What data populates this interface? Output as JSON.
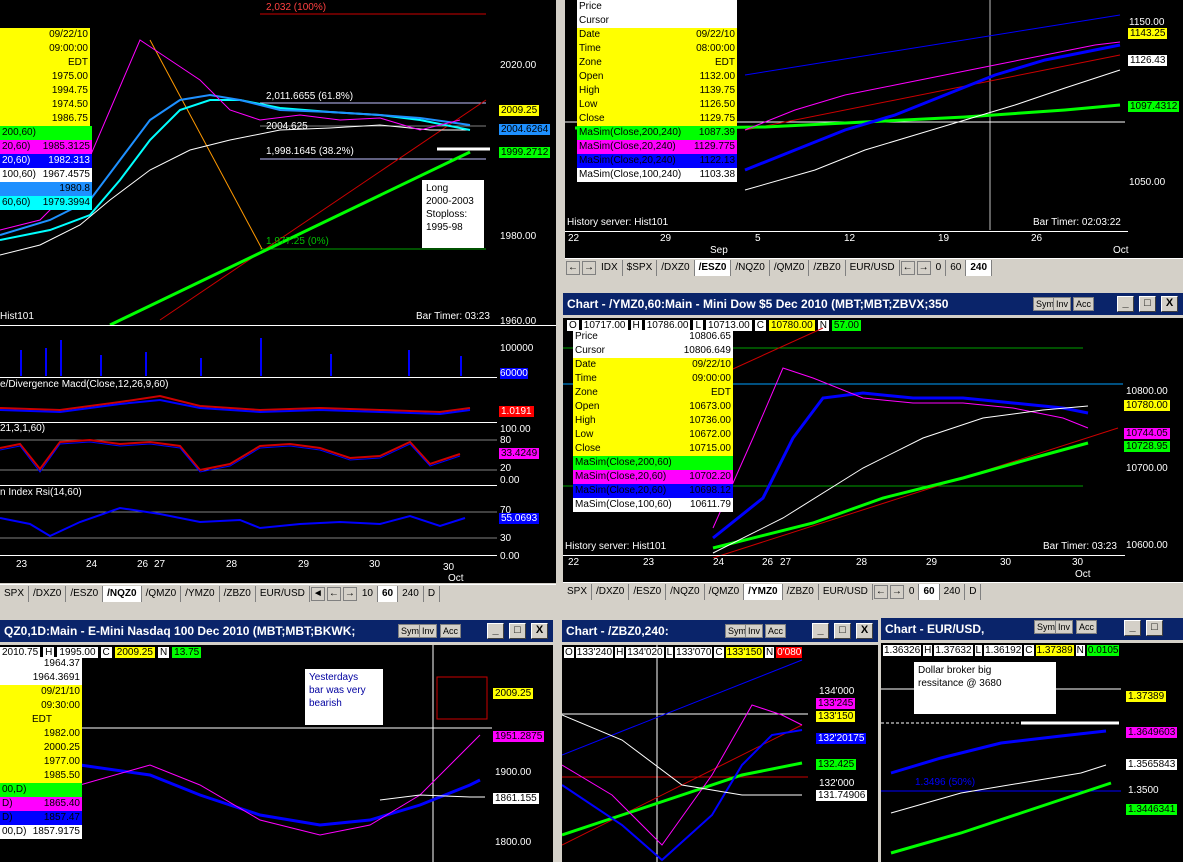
{
  "tl": {
    "info": [
      "09/22/10",
      "09:00:00",
      "EDT",
      "1975.00",
      "1994.75",
      "1974.50",
      "1986.75"
    ],
    "ma": [
      {
        "label": "200,60)",
        "value": "",
        "color": "#00ff00"
      },
      {
        "label": "20,60)",
        "value": "1985.3125",
        "color": "#ff00ff"
      },
      {
        "label": "20,60)",
        "value": "1982.313",
        "color": "#0000ff"
      },
      {
        "label": "100,60)",
        "value": "1967.4575",
        "color": "#ffffff"
      },
      {
        "label": "",
        "value": "1980.8",
        "color": "#1e90ff"
      },
      {
        "label": "60,60)",
        "value": "1979.3994",
        "color": "#00ffff"
      }
    ],
    "fib": [
      "2,032 (100%)",
      "2,011.6655 (61.8%)",
      "2004.625",
      "1,998.1645 (38.2%)",
      "1,977.25 (0%)"
    ],
    "note": "Long\n2000-2003\nStoploss:\n1995-98",
    "price_axis": [
      "2020.00",
      "1980.00",
      "1960.00"
    ],
    "tags": [
      "2009.25",
      "2004.6264",
      "1999.2712"
    ],
    "server": "Hist101",
    "bar_timer": "Bar Timer: 03:23",
    "vol_axis": [
      "100000",
      "60000"
    ],
    "macd_label": "e/Divergence Macd(Close,12,26,9,60)",
    "macd_val": "1.0191",
    "stoch_label": "21,3,1,60)",
    "stoch_axis": [
      "100.00",
      "80",
      "20",
      "0.00"
    ],
    "stoch_val": "33.4249",
    "rsi_label": "n Index Rsi(14,60)",
    "rsi_axis": [
      "70",
      "30",
      "0.00"
    ],
    "rsi_val": "55.0693",
    "dates": [
      "23",
      "24",
      "26",
      "27",
      "28",
      "29",
      "30",
      "30"
    ],
    "oct": "Oct",
    "tabs": [
      "SPX",
      "/DXZ0",
      "/ESZ0",
      "/NQZ0",
      "/QMZ0",
      "/YMZ0",
      "/ZBZ0",
      "EUR/USD"
    ],
    "selected": "/NQZ0",
    "period": [
      "10",
      "60",
      "240",
      "D"
    ]
  },
  "tr": {
    "info": [
      [
        "Price",
        ""
      ],
      [
        "Cursor",
        ""
      ],
      [
        "Date",
        "09/22/10"
      ],
      [
        "Time",
        "08:00:00"
      ],
      [
        "Zone",
        "EDT"
      ],
      [
        "Open",
        "1132.00"
      ],
      [
        "High",
        "1139.75"
      ],
      [
        "Low",
        "1126.50"
      ],
      [
        "Close",
        "1129.75"
      ]
    ],
    "ma": [
      {
        "label": "MaSim(Close,200,240)",
        "value": "1087.39",
        "color": "#00ff00"
      },
      {
        "label": "MaSim(Close,20,240)",
        "value": "1129.775",
        "color": "#ff00ff"
      },
      {
        "label": "MaSim(Close,20,240)",
        "value": "1122.13",
        "color": "#0000ff"
      },
      {
        "label": "MaSim(Close,100,240)",
        "value": "1103.38",
        "color": "#ffffff"
      }
    ],
    "price_axis": [
      "1150.00",
      "1050.00"
    ],
    "tags": [
      "1143.25",
      "1126.43",
      "1097.4312"
    ],
    "server": "History server: Hist101",
    "bar_timer": "Bar Timer: 02:03:22",
    "dates": [
      "22",
      "29",
      "5",
      "12",
      "19",
      "26"
    ],
    "months": [
      "Sep",
      "Oct"
    ],
    "tabs": [
      "IDX",
      "$SPX",
      "/DXZ0",
      "/ESZ0",
      "/NQZ0",
      "/QMZ0",
      "/ZBZ0",
      "EUR/USD"
    ],
    "selected": "/ESZ0",
    "period": [
      "0",
      "60",
      "240"
    ]
  },
  "mr": {
    "title": "Chart - /YMZ0,60:Main - Mini Dow $5 Dec 2010 (MBT;MBT;ZBVX;350",
    "ohlc": [
      "O",
      "10717.00",
      "H",
      "10786.00",
      "L",
      "10713.00",
      "C",
      "10780.00",
      "N",
      "57.00"
    ],
    "info": [
      [
        "Price",
        "10806.65"
      ],
      [
        "Cursor",
        "10806.649"
      ],
      [
        "Date",
        "09/22/10"
      ],
      [
        "Time",
        "09:00:00"
      ],
      [
        "Zone",
        "EDT"
      ],
      [
        "Open",
        "10673.00"
      ],
      [
        "High",
        "10736.00"
      ],
      [
        "Low",
        "10672.00"
      ],
      [
        "Close",
        "10715.00"
      ]
    ],
    "ma": [
      {
        "label": "MaSim(Close,200,60)",
        "value": "",
        "color": "#00ff00"
      },
      {
        "label": "MaSim(Close,20,60)",
        "value": "10702.20",
        "color": "#ff00ff"
      },
      {
        "label": "MaSim(Close,20,60)",
        "value": "10698.12",
        "color": "#0000ff"
      },
      {
        "label": "MaSim(Close,100,60)",
        "value": "10611.79",
        "color": "#ffffff"
      }
    ],
    "price_axis": [
      "10800.00",
      "10700.00",
      "10600.00"
    ],
    "tags": [
      "10780.00",
      "10744.05",
      "10728.95"
    ],
    "server": "History server: Hist101",
    "bar_timer": "Bar Timer: 03:23",
    "dates": [
      "22",
      "23",
      "24",
      "26",
      "27",
      "28",
      "29",
      "30",
      "30"
    ],
    "oct": "Oct",
    "tabs": [
      "SPX",
      "/DXZ0",
      "/ESZ0",
      "/NQZ0",
      "/QMZ0",
      "/YMZ0",
      "/ZBZ0",
      "EUR/USD"
    ],
    "selected": "/YMZ0",
    "period": [
      "0",
      "60",
      "240",
      "D"
    ]
  },
  "bl": {
    "title": "QZ0,1D:Main - E-Mini Nasdaq 100 Dec 2010 (MBT;MBT;BKWK;",
    "ohlc": [
      "2010.75",
      "H",
      "1995.00",
      "C",
      "2009.25",
      "N",
      "13.75"
    ],
    "info": [
      "1964.37",
      "1964.3691",
      "09/21/10",
      "09:30:00",
      "EDT",
      "1982.00",
      "2000.25",
      "1977.00",
      "1985.50"
    ],
    "ma": [
      {
        "label": "00,D)",
        "value": "",
        "color": "#00ff00"
      },
      {
        "label": "D)",
        "value": "1865.40",
        "color": "#ff00ff"
      },
      {
        "label": "D)",
        "value": "1857.47",
        "color": "#0000ff"
      },
      {
        "label": "00,D)",
        "value": "1857.9175",
        "color": "#ffffff"
      }
    ],
    "note": "Yesterdays\nbar was very\nbearish",
    "price_axis": [
      "1900.00",
      "1800.00"
    ],
    "tags": [
      "2009.25",
      "1951.2875",
      "1861.155"
    ]
  },
  "bm": {
    "title": "Chart - /ZBZ0,240:",
    "ohlc": [
      "O",
      "133'240",
      "H",
      "134'020",
      "L",
      "133'070",
      "C",
      "133'150",
      "N",
      "0'080"
    ],
    "price_axis": [
      "134'000",
      "132'000"
    ],
    "tags": [
      "133'245",
      "133'150",
      "132'20175",
      "132.425",
      "131.74906"
    ]
  },
  "br": {
    "title": "Chart - EUR/USD,",
    "ohlc": [
      "1.36326",
      "H",
      "1.37632",
      "L",
      "1.36192",
      "C",
      "1.37389",
      "N",
      "0.0105"
    ],
    "note": "Dollar broker big\nressitance @ 3680",
    "fib": "1.3496 (50%)",
    "price_axis": [
      "1.3500"
    ],
    "tags": [
      "1.37389",
      "1.3649603",
      "1.3565843",
      "1.3446341"
    ]
  },
  "buttons": {
    "sym": "Sym",
    "inv": "Inv",
    "acc": "Acc",
    "min": "_",
    "max": "□",
    "close": "X"
  },
  "colors": {
    "info_bg": "#ffff00",
    "green": "#00ff00",
    "magenta": "#ff00ff",
    "blue": "#0000ff"
  }
}
